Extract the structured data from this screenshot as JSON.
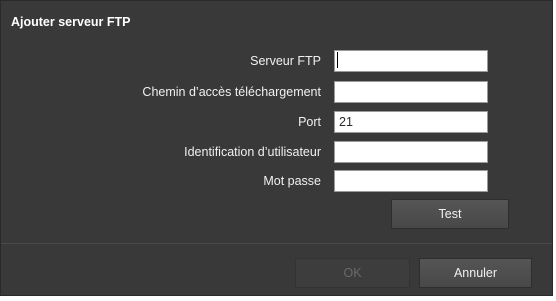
{
  "dialog": {
    "title": "Ajouter serveur FTP"
  },
  "form": {
    "server_label": "Serveur FTP",
    "server_value": "",
    "path_label": "Chemin d’accès téléchargement",
    "path_value": "",
    "port_label": "Port",
    "port_value": "21",
    "user_label": "Identification d’utilisateur",
    "user_value": "",
    "password_label": "Mot passe",
    "password_value": ""
  },
  "buttons": {
    "test": "Test",
    "ok": "OK",
    "cancel": "Annuler"
  }
}
